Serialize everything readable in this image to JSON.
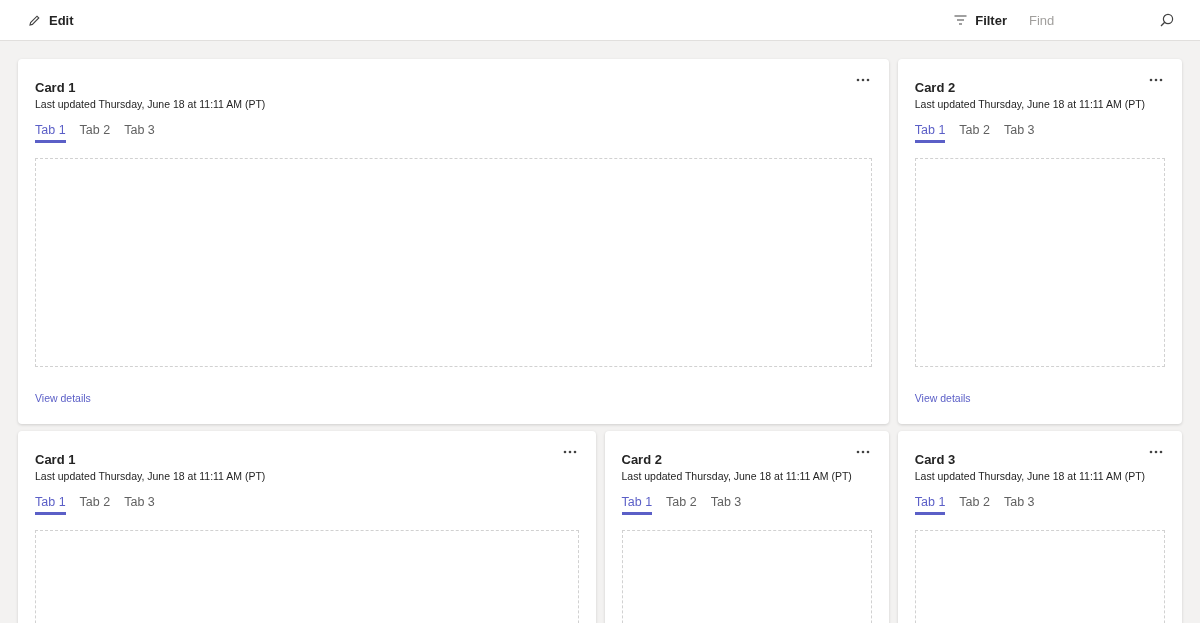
{
  "toolbar": {
    "edit": "Edit",
    "filter": "Filter",
    "search": {
      "placeholder": "Find"
    }
  },
  "rows": [
    {
      "cards": [
        {
          "title": "Card 1",
          "updated": "Last updated Thursday, June 18 at 11:11 AM (PT)",
          "tabs": [
            {
              "label": "Tab 1",
              "selected": true
            },
            {
              "label": "Tab 2",
              "selected": false
            },
            {
              "label": "Tab 3",
              "selected": false
            }
          ],
          "link": "View details"
        },
        {
          "title": "Card 2",
          "updated": "Last updated Thursday, June 18 at 11:11 AM (PT)",
          "tabs": [
            {
              "label": "Tab 1",
              "selected": true
            },
            {
              "label": "Tab 2",
              "selected": false
            },
            {
              "label": "Tab 3",
              "selected": false
            }
          ],
          "link": "View details"
        }
      ]
    },
    {
      "cards": [
        {
          "title": "Card 1",
          "updated": "Last updated Thursday, June 18 at 11:11 AM (PT)",
          "tabs": [
            {
              "label": "Tab 1",
              "selected": true
            },
            {
              "label": "Tab 2",
              "selected": false
            },
            {
              "label": "Tab 3",
              "selected": false
            }
          ]
        },
        {
          "title": "Card 2",
          "updated": "Last updated Thursday, June 18 at 11:11 AM (PT)",
          "tabs": [
            {
              "label": "Tab 1",
              "selected": true
            },
            {
              "label": "Tab 2",
              "selected": false
            },
            {
              "label": "Tab 3",
              "selected": false
            }
          ]
        },
        {
          "title": "Card 3",
          "updated": "Last updated Thursday, June 18 at 11:11 AM (PT)",
          "tabs": [
            {
              "label": "Tab 1",
              "selected": true
            },
            {
              "label": "Tab 2",
              "selected": false
            },
            {
              "label": "Tab 3",
              "selected": false
            }
          ]
        }
      ]
    }
  ]
}
